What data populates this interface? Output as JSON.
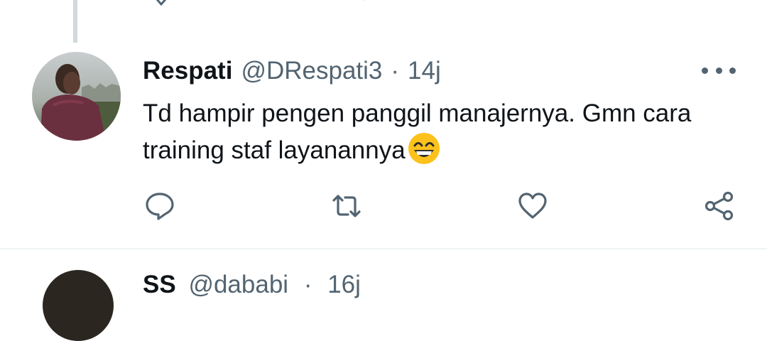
{
  "tweet": {
    "author_name": "Respati",
    "author_handle": "@DRespati3",
    "separator": "·",
    "time": "14j",
    "text": "Td hampir pengen panggil manajernya. Gmn cara training staf layanannya",
    "emoji": "grinning-face-with-smiling-eyes"
  },
  "actions": {
    "icons": [
      "reply-icon",
      "retweet-icon",
      "like-icon",
      "share-icon"
    ]
  },
  "colors": {
    "text_primary": "#0f1419",
    "text_secondary": "#536471",
    "divider": "#eff3f4",
    "thread_line": "#cfd9de"
  },
  "next_tweet": {
    "author_name": "SS",
    "author_handle": "@dababi",
    "time": "16j"
  }
}
